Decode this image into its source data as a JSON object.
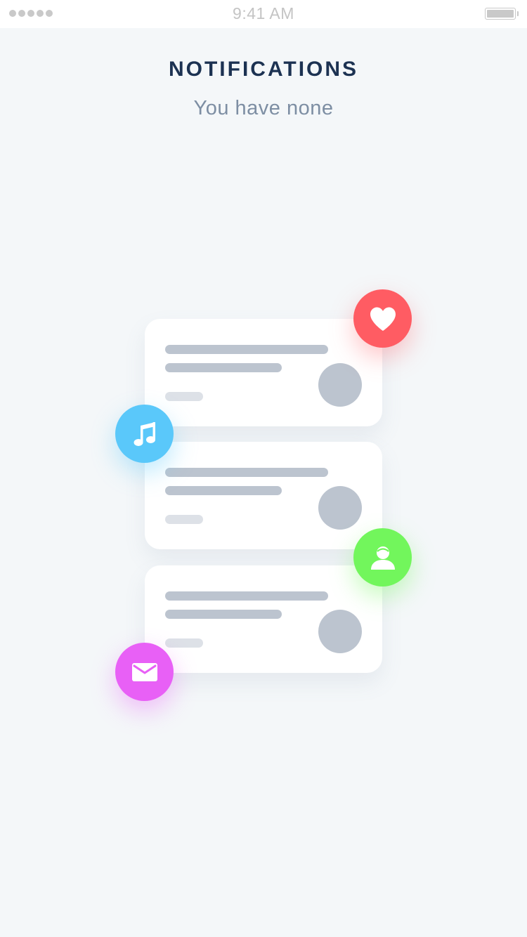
{
  "status_bar": {
    "time": "9:41 AM",
    "signal_icon": "signal-dots-icon",
    "battery_icon": "battery-icon"
  },
  "header": {
    "title": "NOTIFICATIONS",
    "subtitle": "You have none"
  },
  "illustration": {
    "placeholder_card_count": 3,
    "bubbles": [
      {
        "icon": "heart-icon",
        "color": "#ff5c63"
      },
      {
        "icon": "music-note-icon",
        "color": "#5ac8fa"
      },
      {
        "icon": "user-icon",
        "color": "#72f65c"
      },
      {
        "icon": "mail-icon",
        "color": "#e860f6"
      }
    ]
  },
  "colors": {
    "background": "#f4f7f9",
    "title": "#1c3252",
    "subtitle": "#7d8ea3",
    "placeholder": "#bcc4cf"
  }
}
